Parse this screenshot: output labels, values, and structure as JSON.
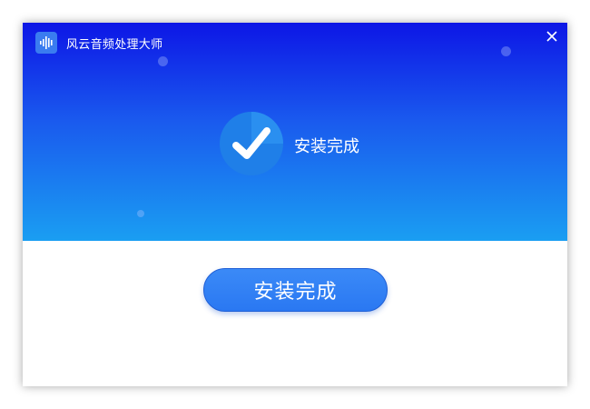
{
  "window": {
    "title": "风云音频处理大师",
    "logo_icon": "audio-waveform-icon",
    "close_icon": "close-icon"
  },
  "status": {
    "icon": "checkmark-icon",
    "text": "安装完成"
  },
  "actions": {
    "finish_label": "安装完成"
  },
  "colors": {
    "header_top": "#0d16e6",
    "header_bottom": "#1a9ef2",
    "button": "#2f80f5",
    "check_circle": "#1f7fe8"
  }
}
